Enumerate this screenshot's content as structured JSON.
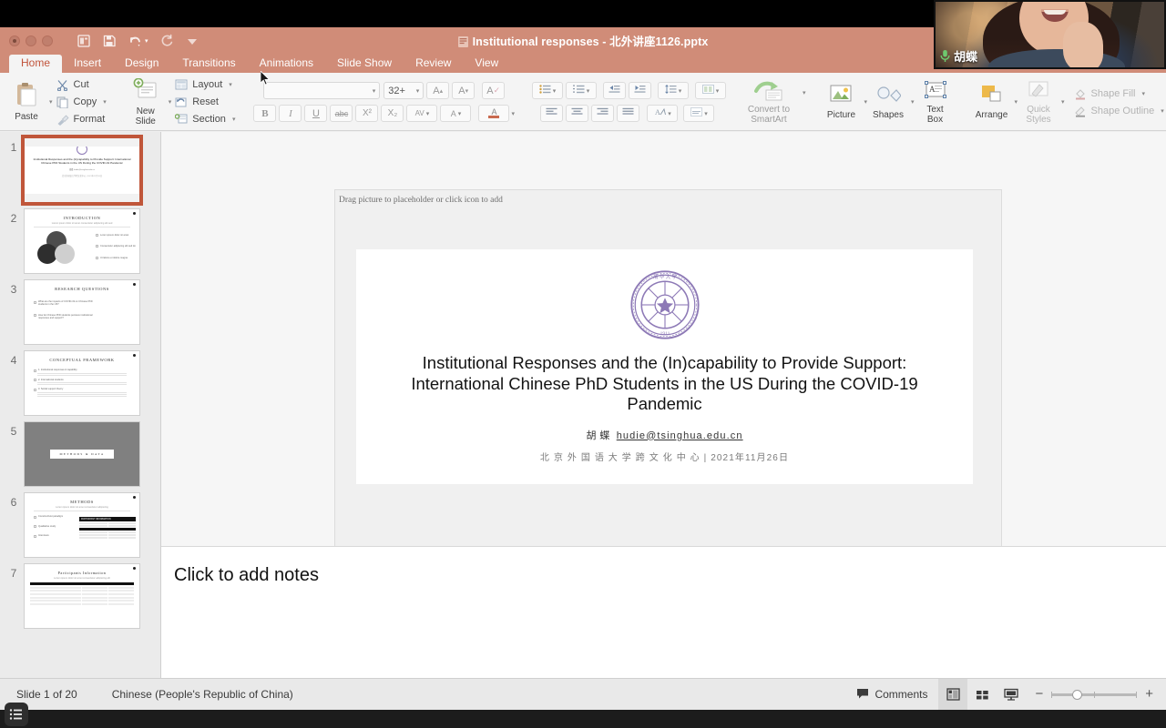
{
  "app": {
    "document_title": "Institutional responses - 北外讲座1126.pptx",
    "accent_color": "#d08c78",
    "active_tab_color": "#c1543b"
  },
  "quick_access": [
    {
      "name": "new-presentation-icon",
      "label": "New Presentation"
    },
    {
      "name": "save-icon",
      "label": "Save"
    },
    {
      "name": "undo-icon",
      "label": "Undo"
    },
    {
      "name": "redo-icon",
      "label": "Redo"
    },
    {
      "name": "customize-toolbar-icon",
      "label": "Customize"
    }
  ],
  "ribbon": {
    "tabs": [
      {
        "label": "Home",
        "active": true
      },
      {
        "label": "Insert",
        "active": false
      },
      {
        "label": "Design",
        "active": false
      },
      {
        "label": "Transitions",
        "active": false
      },
      {
        "label": "Animations",
        "active": false
      },
      {
        "label": "Slide Show",
        "active": false
      },
      {
        "label": "Review",
        "active": false
      },
      {
        "label": "View",
        "active": false
      }
    ],
    "clipboard": {
      "paste": "Paste",
      "cut": "Cut",
      "copy": "Copy",
      "format": "Format"
    },
    "slides": {
      "new_slide_line1": "New",
      "new_slide_line2": "Slide",
      "layout": "Layout",
      "reset": "Reset",
      "section": "Section"
    },
    "font": {
      "family_value": "",
      "family_placeholder": "",
      "size_value": "32+",
      "grow_label": "A",
      "shrink_label": "A",
      "clear_format_label": "A",
      "bold": "B",
      "italic": "I",
      "underline": "U",
      "strikethrough": "abc",
      "superscript": "X²",
      "subscript": "X₂",
      "char_spacing": "AV",
      "text_effects": "A",
      "font_color": "A"
    },
    "paragraph": {
      "bullets": "Bullets",
      "numbering": "Numbering",
      "decrease_indent": "Decrease Indent",
      "increase_indent": "Increase Indent",
      "line_spacing": "Line Spacing",
      "columns": "Columns",
      "align_left": "Align Left",
      "align_center": "Center",
      "align_right": "Align Right",
      "justify": "Justify",
      "text_direction": "Text Direction",
      "align_text": "Align Text",
      "convert_line1": "Convert to",
      "convert_line2": "SmartArt"
    },
    "insert": {
      "picture": "Picture",
      "shapes": "Shapes",
      "textbox_line1": "Text",
      "textbox_line2": "Box"
    },
    "format": {
      "arrange": "Arrange",
      "quick_line1": "Quick",
      "quick_line2": "Styles",
      "shape_fill": "Shape Fill",
      "shape_outline": "Shape Outline"
    }
  },
  "slide_pane": {
    "thumbnails": [
      {
        "number": "1",
        "title": "Institutional Responses and the (In)capability to Provide Support: International Chinese PhD Students in the US During the COVID-19 Pandemic",
        "kind": "title",
        "selected": true
      },
      {
        "number": "2",
        "title": "INTRODUCTION",
        "kind": "venn",
        "selected": false
      },
      {
        "number": "3",
        "title": "RESEARCH QUESTIONS",
        "kind": "bullets",
        "selected": false
      },
      {
        "number": "4",
        "title": "CONCEPTUAL FRAMEWORK",
        "kind": "bullets-dense",
        "selected": false
      },
      {
        "number": "5",
        "title": "METHODS & DATA",
        "kind": "section",
        "selected": false
      },
      {
        "number": "6",
        "title": "METHODS",
        "kind": "methods",
        "selected": false
      },
      {
        "number": "7",
        "title": "Participants Information",
        "kind": "table",
        "selected": false
      }
    ]
  },
  "slide": {
    "placeholder_prompt": "Drag picture to placeholder or click icon to add",
    "logo_name": "tsinghua-university-seal",
    "logo_color": "#8d79b6",
    "title": "Institutional Responses and the (In)capability to Provide Support: International Chinese PhD Students in the US During the COVID-19 Pandemic",
    "author": "胡 蝶",
    "email": "hudie@tsinghua.edu.cn",
    "affiliation": "北 京 外 国 语 大 学 跨 文 化 中 心   |   2021年11月26日"
  },
  "notes": {
    "placeholder": "Click to add notes"
  },
  "status_bar": {
    "slide_counter": "Slide 1 of 20",
    "language": "Chinese (People's Republic of China)",
    "comments": "Comments",
    "views": [
      {
        "name": "normal-view-button",
        "label": "Normal View",
        "active": true
      },
      {
        "name": "slide-sorter-button",
        "label": "Slide Sorter",
        "active": false
      },
      {
        "name": "slideshow-button",
        "label": "Slide Show",
        "active": false
      }
    ],
    "zoom_out": "−",
    "zoom_in": "+"
  },
  "webcam": {
    "participant_name": "胡蝶",
    "mic_icon": "microphone-on-icon"
  },
  "dock": {
    "icon_name": "outline-list-icon"
  }
}
